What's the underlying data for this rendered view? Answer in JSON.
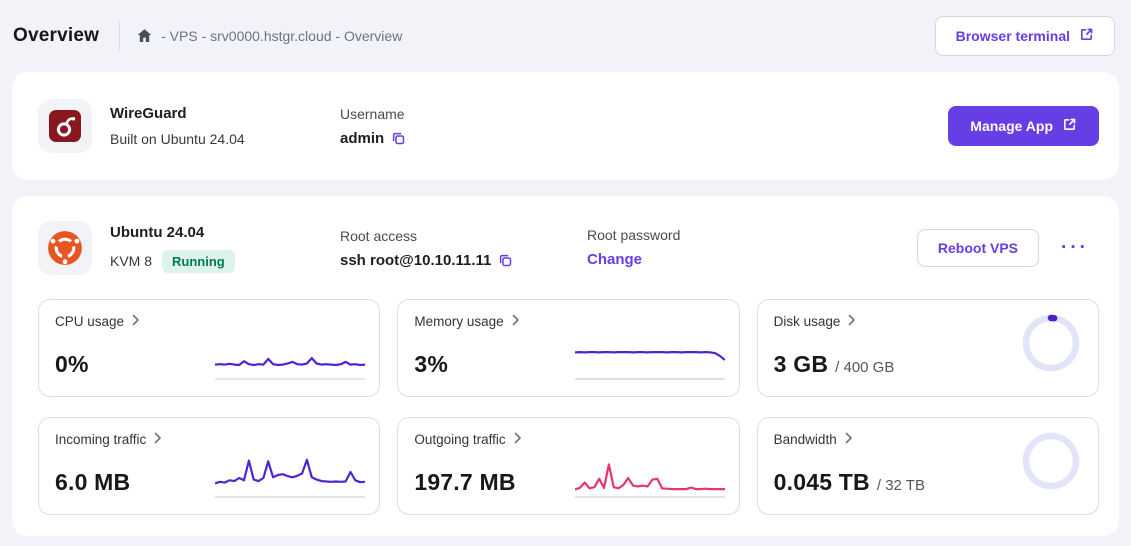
{
  "header": {
    "title": "Overview",
    "breadcrumb": "- VPS - srv0000.hstgr.cloud - Overview",
    "browser_terminal_label": "Browser terminal"
  },
  "app_card": {
    "name": "WireGuard",
    "subtitle": "Built on Ubuntu 24.04",
    "username_label": "Username",
    "username_value": "admin",
    "manage_label": "Manage App"
  },
  "vps_card": {
    "os_name": "Ubuntu 24.04",
    "plan": "KVM 8",
    "status": "Running",
    "root_access_label": "Root access",
    "root_access_value": "ssh root@10.10.11.11",
    "root_password_label": "Root password",
    "change_label": "Change",
    "reboot_label": "Reboot VPS",
    "kebab_label": "···"
  },
  "colors": {
    "brand_purple": "#673de6",
    "spark_purple": "#5025d1",
    "spark_pink": "#e5366f",
    "donut_track": "#e2e5f9",
    "donut_fill": "#4c20c8",
    "badge_bg": "#def3ea",
    "badge_text": "#00795c",
    "wireguard_red": "#88171f",
    "ubuntu_orange": "#e95420"
  },
  "chart_data": [
    {
      "type": "line",
      "title": "CPU usage",
      "value_label": "0%",
      "series": [
        {
          "name": "cpu",
          "values": [
            30,
            31,
            30,
            32,
            30,
            29,
            39,
            31,
            29,
            31,
            30,
            45,
            31,
            29,
            30,
            33,
            37,
            31,
            30,
            33,
            47,
            33,
            30,
            31,
            30,
            29,
            31,
            37,
            30,
            31,
            29,
            30
          ]
        }
      ]
    },
    {
      "type": "line",
      "title": "Memory usage",
      "value_label": "3%",
      "series": [
        {
          "name": "memory",
          "values": [
            62,
            63,
            62,
            63,
            63,
            62,
            63,
            63,
            62,
            63,
            63,
            63,
            62,
            63,
            63,
            62,
            63,
            63,
            63,
            62,
            63,
            63,
            62,
            63,
            63,
            63,
            62,
            63,
            62,
            60,
            52,
            42
          ]
        }
      ]
    },
    {
      "type": "donut",
      "title": "Disk usage",
      "value_label": "3 GB",
      "total_label": "/ 400 GB",
      "percent": 2
    },
    {
      "type": "line",
      "title": "Incoming traffic",
      "value_label": "6.0 MB",
      "series": [
        {
          "name": "incoming",
          "values": [
            28,
            32,
            30,
            36,
            34,
            42,
            36,
            88,
            38,
            34,
            42,
            86,
            44,
            50,
            52,
            47,
            44,
            48,
            54,
            90,
            44,
            38,
            34,
            33,
            32,
            33,
            32,
            33,
            58,
            36,
            31,
            32
          ]
        }
      ]
    },
    {
      "type": "line",
      "title": "Outgoing traffic",
      "value_label": "197.7 MB",
      "series": [
        {
          "name": "outgoing",
          "values": [
            12,
            16,
            30,
            15,
            18,
            40,
            16,
            78,
            18,
            15,
            24,
            42,
            22,
            20,
            22,
            20,
            38,
            40,
            15,
            14,
            13,
            13,
            13,
            13,
            17,
            13,
            13,
            14,
            13,
            13,
            13,
            13
          ]
        }
      ]
    },
    {
      "type": "donut",
      "title": "Bandwidth",
      "value_label": "0.045 TB",
      "total_label": "/ 32 TB",
      "percent": 0
    }
  ],
  "tiles": [
    {
      "id": "cpu-usage",
      "label": "CPU usage",
      "value": "0%",
      "suffix": "",
      "viz": "line",
      "color": "#5025d1",
      "baseline": "#d8d3ef"
    },
    {
      "id": "memory-usage",
      "label": "Memory usage",
      "value": "3%",
      "suffix": "",
      "viz": "line",
      "color": "#5025d1",
      "baseline": "#bfcfe6"
    },
    {
      "id": "disk-usage",
      "label": "Disk usage",
      "value": "3 GB",
      "suffix": "/ 400 GB",
      "viz": "donut",
      "percent": 2
    },
    {
      "id": "incoming-traffic",
      "label": "Incoming traffic",
      "value": "6.0 MB",
      "suffix": "",
      "viz": "line",
      "color": "#5025d1",
      "baseline": "#cfd2dc"
    },
    {
      "id": "outgoing-traffic",
      "label": "Outgoing traffic",
      "value": "197.7 MB",
      "suffix": "",
      "viz": "line",
      "color": "#e5366f",
      "baseline": "#cfd2dc"
    },
    {
      "id": "bandwidth",
      "label": "Bandwidth",
      "value": "0.045 TB",
      "suffix": "/ 32 TB",
      "viz": "donut",
      "percent": 0
    }
  ]
}
